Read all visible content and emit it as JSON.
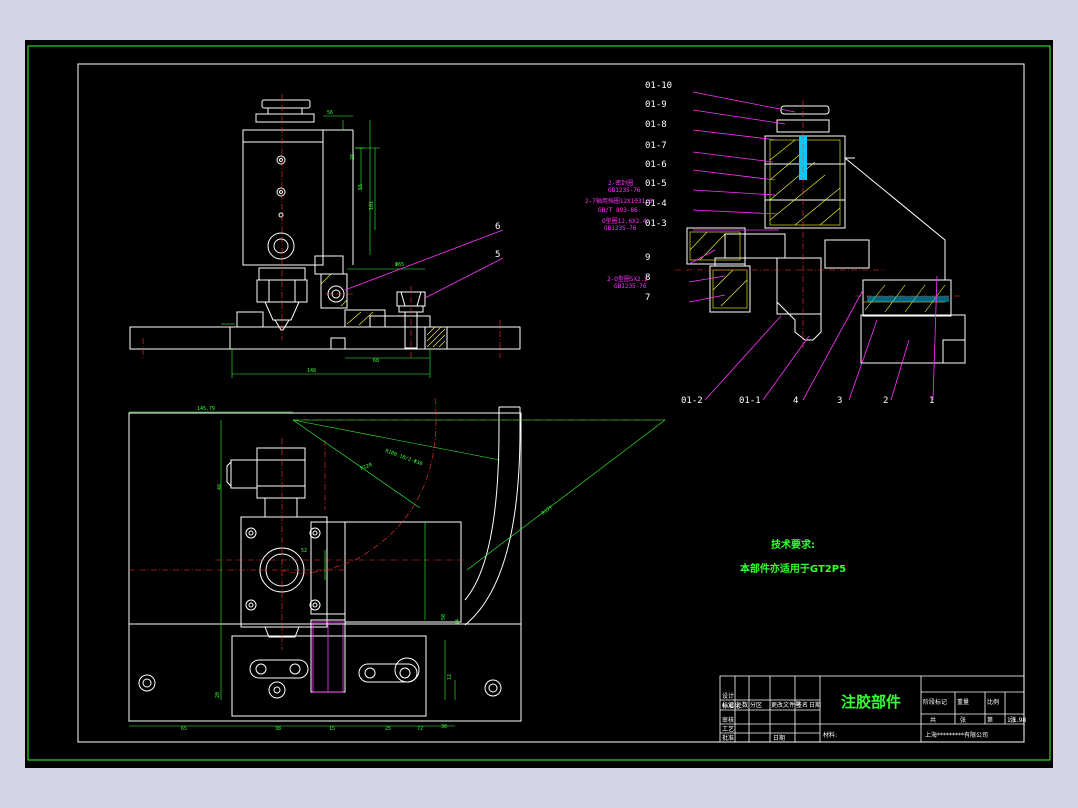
{
  "drawing": {
    "part_labels_left": [
      "01-10",
      "01-9",
      "01-8",
      "01-7",
      "01-6",
      "01-5",
      "01-4",
      "01-3",
      "9",
      "8",
      "7"
    ],
    "part_labels_bottom": [
      "01-2",
      "01-1",
      "4",
      "3",
      "2",
      "1"
    ],
    "callouts_top_view": [
      "6",
      "5"
    ],
    "spec_notes": [
      "2-密封圈",
      "GB1235-76",
      "2-7轴用挡圈12X1031.8",
      "GB/T 893-86",
      "O型圈12.6X2.4",
      "GB1235-76",
      "2-O型圈5X2.2",
      "GB1235-76"
    ],
    "dimensions": [
      "56",
      "28",
      "55",
      "101",
      "Φ65",
      "148",
      "68",
      "145.79",
      "R128",
      "R100.18/2-Φ30",
      "R177",
      "30",
      "12",
      "20",
      "65",
      "38",
      "15",
      "25",
      "72",
      "50",
      "14",
      "48",
      "52"
    ],
    "tech_requirements": {
      "heading": "技术要求:",
      "line": "本部件亦适用于GT2P5"
    },
    "colors": {
      "outline": "#ffffff",
      "border": "#33ff33",
      "leader": "#ff33ff",
      "center": "#ff3333",
      "accent": "#00ffff",
      "hatch": "#ffff33"
    }
  },
  "title_block": {
    "title": "注胶部件",
    "material_label": "材料:",
    "company": "上海*********有限公司",
    "scale": "1:1.98",
    "header_cells": [
      "标记",
      "处数",
      "分区",
      "更改文件号",
      "签名",
      "日期"
    ],
    "role_cells": [
      "设计",
      "标准化",
      "审核",
      "工艺",
      "批准"
    ],
    "right_headers": [
      "阶段标记",
      "重量",
      "比例"
    ],
    "sheet_cells": [
      "共",
      "张",
      "第",
      "张"
    ],
    "date_label": "日期"
  }
}
